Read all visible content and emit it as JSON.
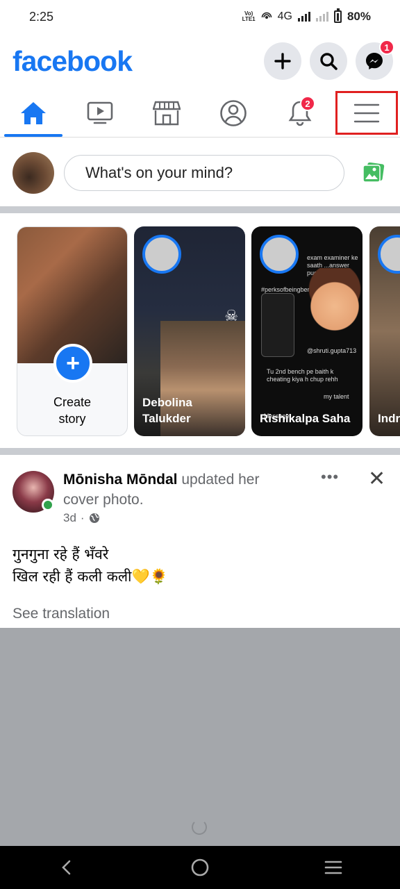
{
  "status_bar": {
    "time": "2:25",
    "volte_label": "Vo) LTE1",
    "network": "4G",
    "battery": "80%"
  },
  "header": {
    "logo": "facebook",
    "messenger_badge": "1"
  },
  "tabs": [
    {
      "name": "home",
      "active": true
    },
    {
      "name": "watch"
    },
    {
      "name": "marketplace"
    },
    {
      "name": "profile"
    },
    {
      "name": "notifications",
      "badge": "2"
    },
    {
      "name": "menu",
      "highlighted": true
    }
  ],
  "composer": {
    "placeholder": "What's on your mind?"
  },
  "stories": [
    {
      "type": "create",
      "label_line1": "Create",
      "label_line2": "story"
    },
    {
      "name_line1": "Debolina",
      "name_line2": "Talukder"
    },
    {
      "name_line1": "Rishikalpa Saha",
      "name_line2": ""
    },
    {
      "name_line1": "Indr",
      "name_line2": ""
    }
  ],
  "story3_overlay": {
    "line1": "exam examiner ke saath ...answer pucha",
    "hashtag": "#perksofbeingbengali",
    "handle": "@shruti.gupta713",
    "chat_text": "Tu 2nd bench pe baith k cheating kiya h chup rehh",
    "reply": "my talent",
    "message_placeholder": "Message..."
  },
  "post": {
    "author": "Mōnisha Mōndal",
    "action": "updated her cover photo.",
    "time": "3d",
    "text_line1": "गुनगुना रहे हैं भँवरे",
    "text_line2": "खिल रही हैं कली कली💛🌻",
    "translate": "See translation",
    "more": "•••",
    "close": "✕"
  },
  "colors": {
    "brand": "#1877f2",
    "badge": "#f02849",
    "highlight_box": "#e02020",
    "online": "#31a24c"
  }
}
